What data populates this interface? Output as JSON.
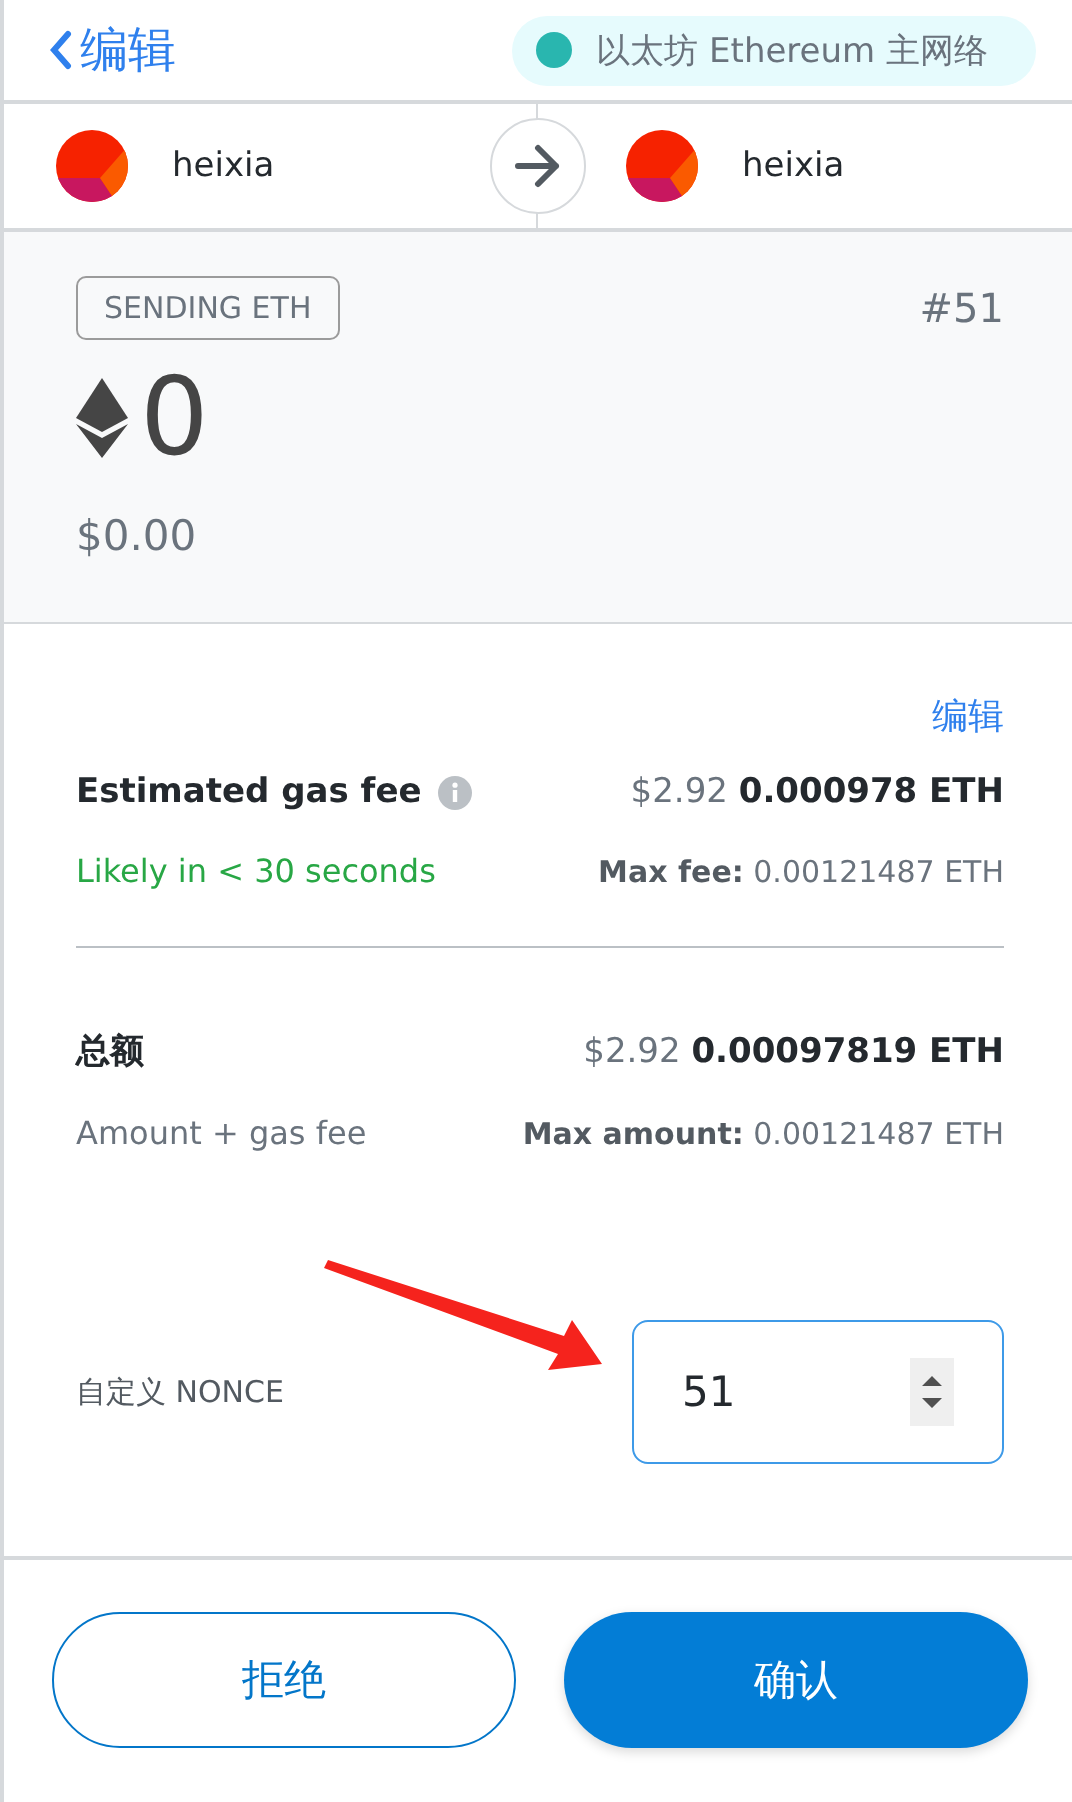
{
  "header": {
    "back": "编辑",
    "network": {
      "name": "以太坊 Ethereum 主网络",
      "color": "#29b6af"
    }
  },
  "accounts": {
    "sender": "heixia",
    "recipient": "heixia"
  },
  "summary": {
    "badge": "SENDING ETH",
    "nonce": "#51",
    "amount": "0",
    "fiat": "$0.00"
  },
  "edit_link": "编辑",
  "gas": {
    "label": "Estimated gas fee",
    "value": "$2.92 **0.000978 ETH**",
    "timing": "Likely in < 30 seconds",
    "max": "**Max fee:** 0.00121487 ETH"
  },
  "total": {
    "label": "总额",
    "value": "$2.92 **0.00097819 ETH**",
    "subtitle": "Amount + gas fee",
    "max": "**Max amount:** 0.00121487 ETH"
  },
  "custom_nonce": {
    "label": "自定义 NONCE",
    "value": "51"
  },
  "buttons": {
    "reject": "拒绝",
    "confirm": "确认"
  }
}
